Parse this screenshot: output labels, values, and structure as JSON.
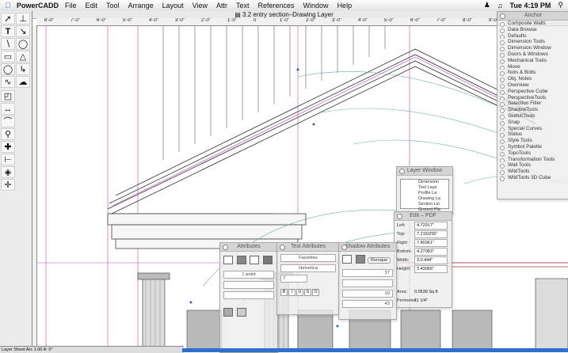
{
  "menubar": {
    "app": "PowerCADD",
    "items": [
      "File",
      "Edit",
      "Tool",
      "Arrange",
      "Layout",
      "View",
      "Attr",
      "Text",
      "References",
      "Window",
      "Help"
    ],
    "clock": "Tue 4:19 PM"
  },
  "document": {
    "title": "3.2 entry section–Drawing Layer"
  },
  "ruler": {
    "marks": [
      "8'-0\"",
      "7'-0\"",
      "6'-0\"",
      "5'-0\"",
      "4'-0\"",
      "3'-0\"",
      "2'-0\"",
      "1'-0\"",
      "0",
      "1'-0\"",
      "2'-0\"",
      "3'-0\"",
      "4'-0\"",
      "5'-0\"",
      "6'-0\"",
      "7'-0\"",
      "8'-0\"",
      "9'-0\"",
      "10'",
      "11'"
    ]
  },
  "anchor": {
    "title": "Anchor",
    "items": [
      "Composite Walls",
      "Data Browse",
      "Defaults",
      "Dimension Tools",
      "Dimension Window",
      "Doors & Windows",
      "Mechanical Tools",
      "Move",
      "Nuts & Bolts",
      "Obj. Notes",
      "Overview",
      "Perspective Cube",
      "PerspectiveTools",
      "Selection Filter",
      "ShadowTools",
      "SketchTools",
      "Snap",
      "Special Curves",
      "Status",
      "Style Tools",
      "Symbol Palette",
      "TopoTools",
      "Transformation Tools",
      "Wall Tools",
      "WildTools",
      "WildTools 3D Cube"
    ]
  },
  "layer_window": {
    "title": "Layer Window",
    "layers": [
      "Dimension",
      "Text Laye",
      "Profile La",
      "Drawing La",
      "Section Lin",
      "Ground Pla"
    ]
  },
  "edit_pdf": {
    "title": "Edit – PDF",
    "fields": [
      {
        "label": "Left:",
        "value": "4.72917\""
      },
      {
        "label": "Top:",
        "value": "7.215/256\""
      },
      {
        "label": "Right:",
        "value": "7.80361\""
      },
      {
        "label": "Bottom:",
        "value": "4.27083\""
      },
      {
        "label": "Width:",
        "value": "3.0.444\""
      },
      {
        "label": "Height:",
        "value": "3.43056\""
      }
    ],
    "area_label": "Area:",
    "area_value": "0.0539 Sq ft",
    "perim_label": "Perimeter:",
    "perim_value": "11 1/4\""
  },
  "attributes": {
    "title": "Attributes",
    "pen": "1 point"
  },
  "text_attributes": {
    "title": "Text Attributes",
    "style_set": "Favorites",
    "font": "Helvetica",
    "size": "7",
    "style_buttons": [
      "B",
      "I",
      "U",
      "S",
      "O"
    ]
  },
  "shadow_attributes": {
    "title": "Shadow Attributes",
    "button": "Reroque",
    "value1": "37",
    "value2": "10",
    "value3": "43"
  },
  "status": {
    "text": "Layer  Sheet  Arc  1.00  A: 0°"
  }
}
